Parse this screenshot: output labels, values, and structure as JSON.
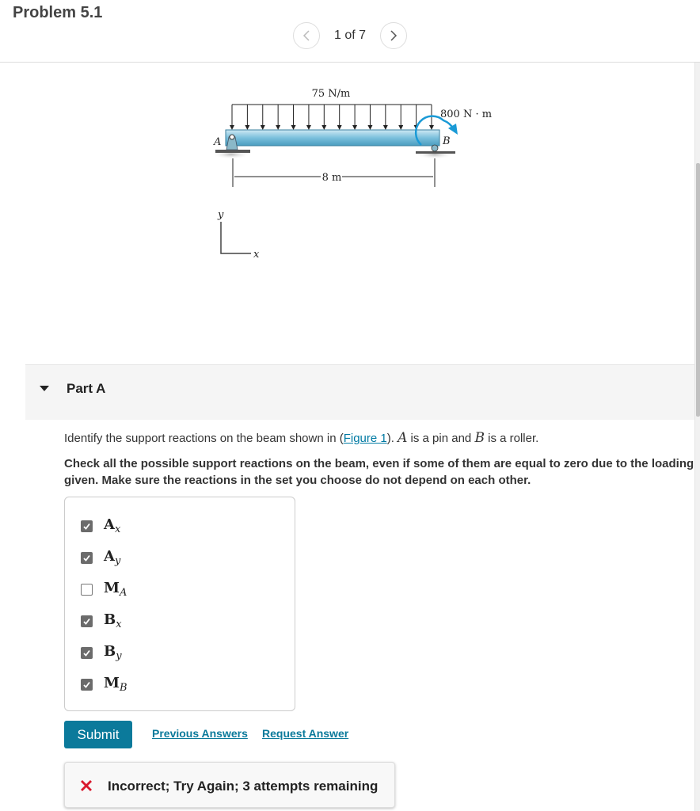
{
  "header": {
    "problem_title": "Problem 5.1",
    "pager": {
      "current": 1,
      "total": 7,
      "text": "1 of 7",
      "prev_icon": "chevron-left-icon",
      "next_icon": "chevron-right-icon"
    }
  },
  "figure": {
    "distributed_load_label": "75 N/m",
    "moment_label": "800 N · m",
    "span_label": "8 m",
    "point_a_label": "A",
    "point_b_label": "B",
    "axis_x_label": "x",
    "axis_y_label": "y",
    "beam_color": "#6fb8d6",
    "moment_color": "#1a9ad6"
  },
  "part": {
    "label": "Part A",
    "expanded": true,
    "instruction_pre": "Identify the support reactions on the beam shown in (",
    "figure_link": "Figure 1",
    "instruction_post1": "). ",
    "var_a": "A",
    "instruction_mid": " is a pin and ",
    "var_b": "B",
    "instruction_post2": " is a roller.",
    "instruction_bold": "Check all the possible support reactions on the beam, even if some of them are equal to zero due to the loading given. Make sure the reactions in the set you choose do not depend on each other.",
    "choices": [
      {
        "main": "A",
        "sub": "x",
        "checked": true
      },
      {
        "main": "A",
        "sub": "y",
        "checked": true
      },
      {
        "main": "M",
        "sub": "A",
        "checked": false
      },
      {
        "main": "B",
        "sub": "x",
        "checked": true
      },
      {
        "main": "B",
        "sub": "y",
        "checked": true
      },
      {
        "main": "M",
        "sub": "B",
        "checked": true
      }
    ],
    "submit_label": "Submit",
    "previous_answers_label": "Previous Answers",
    "request_answer_label": "Request Answer",
    "feedback": {
      "icon": "x-mark-icon",
      "text": "Incorrect; Try Again; 3 attempts remaining",
      "icon_color": "#d9182d"
    }
  }
}
